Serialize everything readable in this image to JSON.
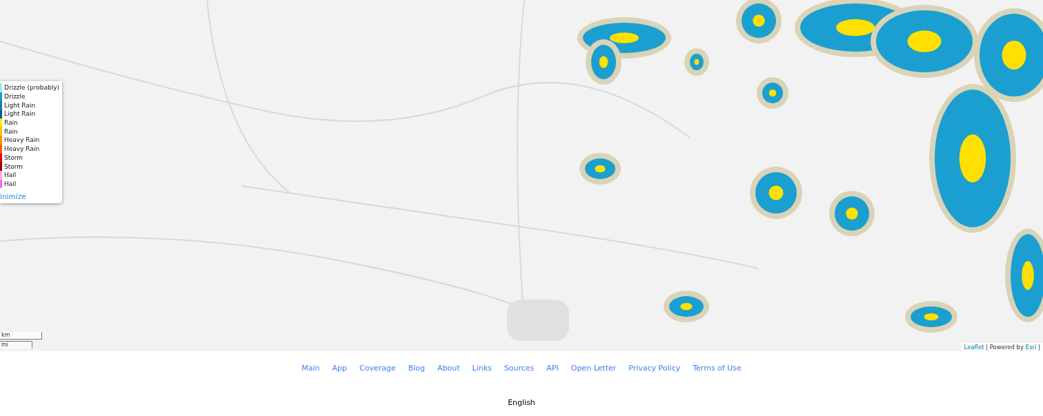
{
  "legend": {
    "items": [
      {
        "label": "Drizzle (probably)",
        "color": "#9be8f0"
      },
      {
        "label": "Drizzle",
        "color": "#14a0d0"
      },
      {
        "label": "Light Rain",
        "color": "#1280b8"
      },
      {
        "label": "Light Rain",
        "color": "#0a5a90"
      },
      {
        "label": "Rain",
        "color": "#ffee00"
      },
      {
        "label": "Rain",
        "color": "#ffc400"
      },
      {
        "label": "Heavy Rain",
        "color": "#ff9000"
      },
      {
        "label": "Heavy Rain",
        "color": "#ff5a00"
      },
      {
        "label": "Storm",
        "color": "#ee0000"
      },
      {
        "label": "Storm",
        "color": "#a00000"
      },
      {
        "label": "Hail",
        "color": "#ffaaee"
      },
      {
        "label": "Hail",
        "color": "#ff66ee"
      }
    ],
    "toggle": "inimize"
  },
  "scale": {
    "metric": "km",
    "imperial": "mi"
  },
  "attribution": {
    "parts": [
      {
        "text": "Leaflet",
        "kind": "link"
      },
      {
        "text": " | Powered by ",
        "kind": "text"
      },
      {
        "text": "Esri",
        "kind": "link"
      },
      {
        "text": " |",
        "kind": "text"
      }
    ]
  },
  "footer": {
    "links": [
      "Main",
      "App",
      "Coverage",
      "Blog",
      "About",
      "Links",
      "Sources",
      "API",
      "Open Letter",
      "Privacy Policy",
      "Terms of Use"
    ],
    "language": "English"
  }
}
